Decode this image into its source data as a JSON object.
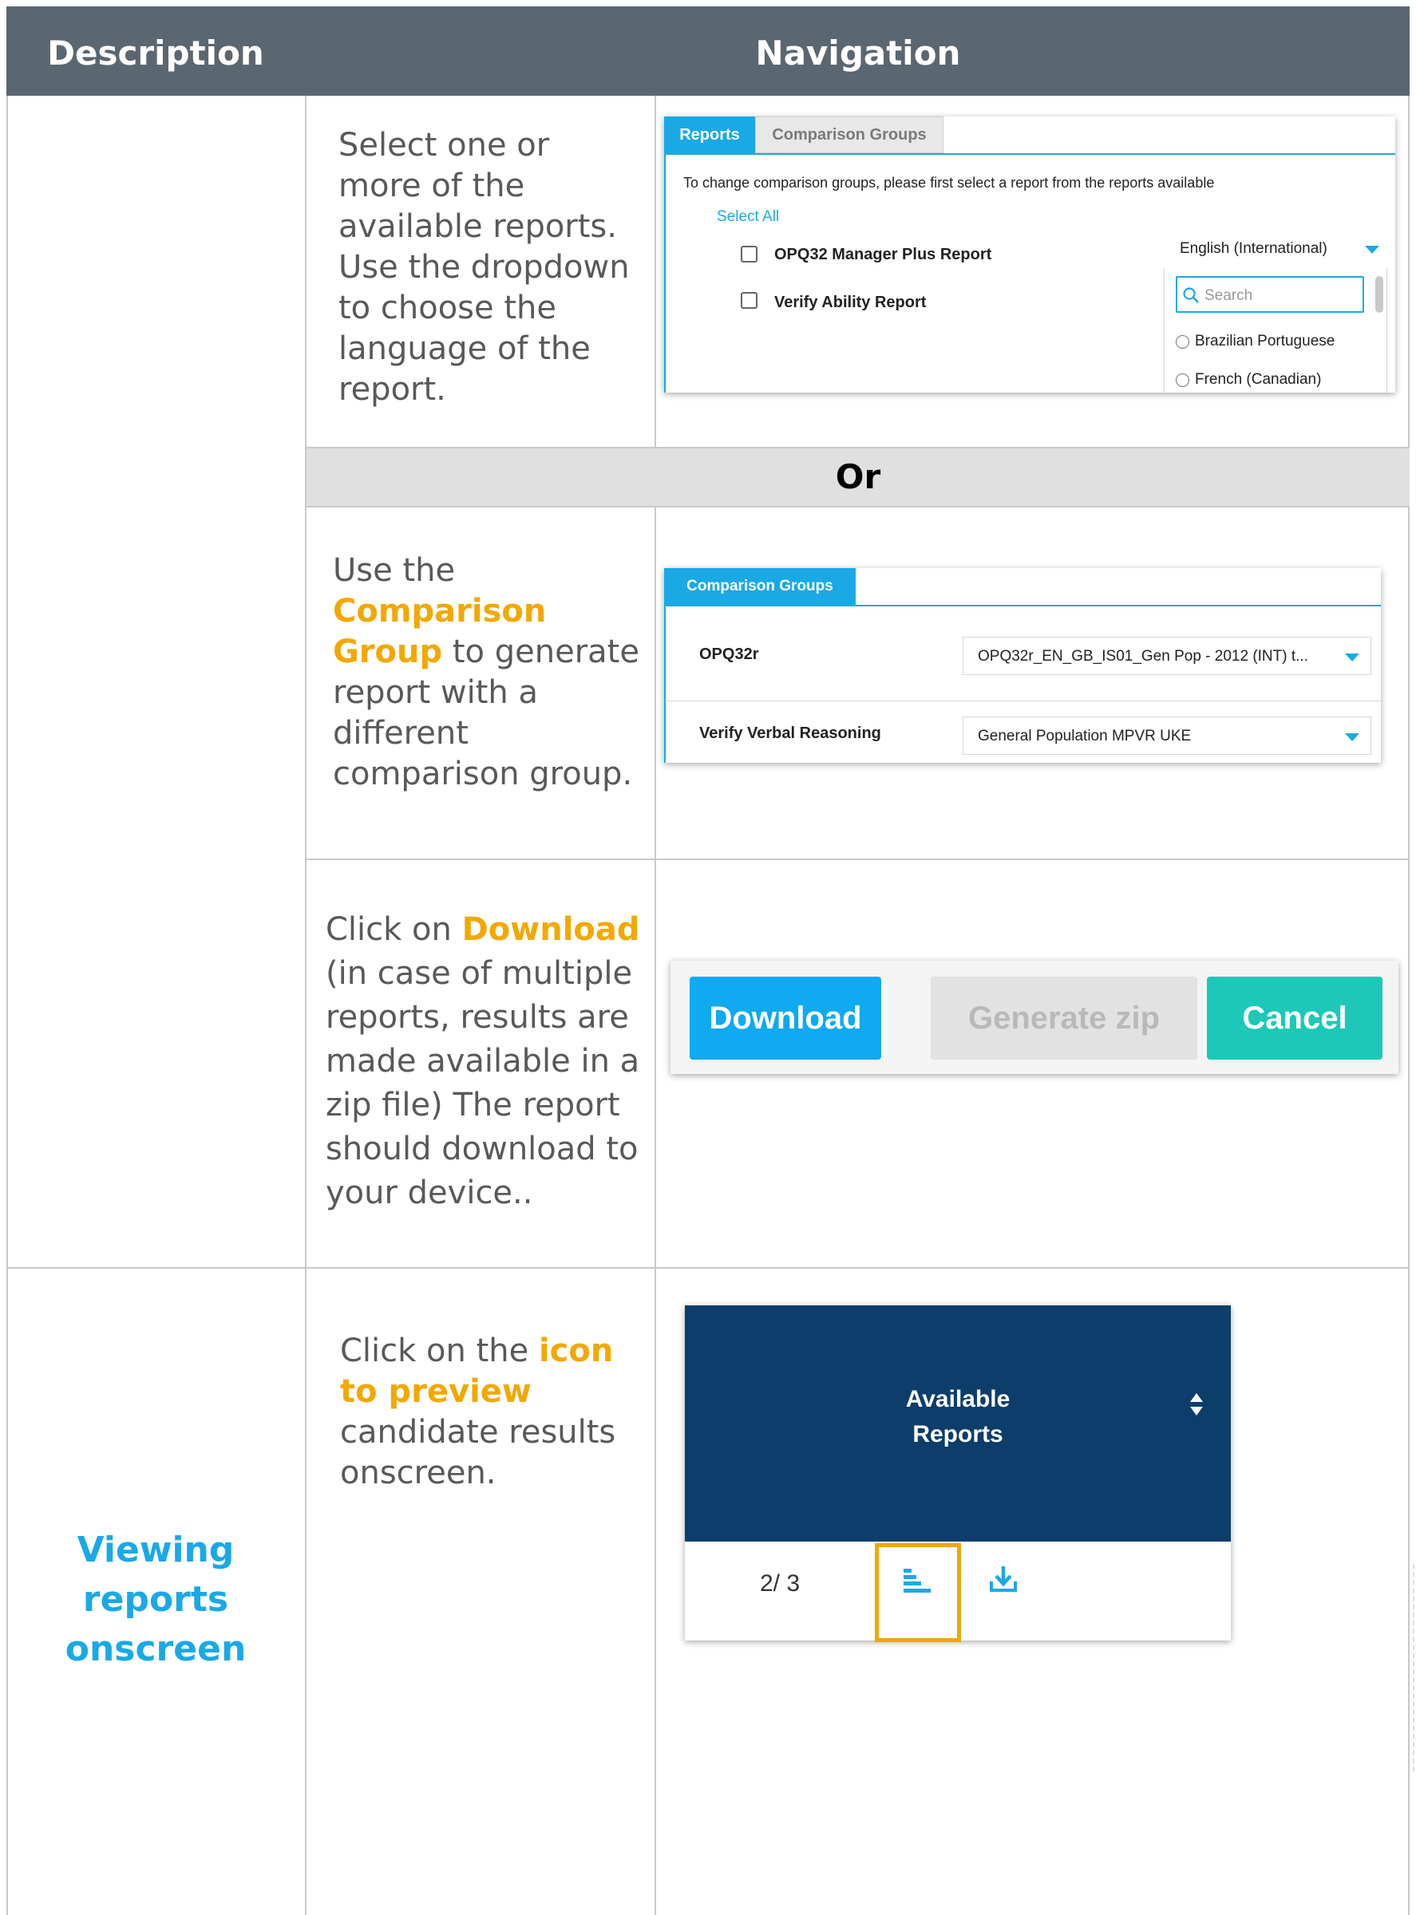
{
  "header": {
    "description": "Description",
    "navigation": "Navigation"
  },
  "rows": {
    "select_reports": {
      "text": "Select one or more of the available reports. Use the dropdown to choose the language of the report."
    },
    "or_label": "Or",
    "comparison": {
      "text_before": "Use the ",
      "highlight": "Comparison Group",
      "text_after": " to generate report with a different comparison group."
    },
    "download": {
      "text_before": "Click on ",
      "highlight": "Download",
      "text_after": " (in case of multiple reports, results are made available in a zip file) The report should download to your device.."
    },
    "viewing": {
      "section_title": "Viewing reports onscreen",
      "text_before": "Click on the ",
      "highlight": "icon to preview",
      "text_after": " candidate results onscreen."
    }
  },
  "reports_panel": {
    "tabs": [
      "Reports",
      "Comparison Groups"
    ],
    "instruction": "To change comparison groups, please first select a report from the reports available",
    "select_all": "Select All",
    "reports": [
      "OPQ32 Manager Plus Report",
      "Verify Ability Report"
    ],
    "language_selected": "English (International)",
    "search_placeholder": "Search",
    "language_options": [
      "Brazilian Portuguese",
      "French (Canadian)"
    ]
  },
  "comparison_panel": {
    "tab": "Comparison Groups",
    "rows": [
      {
        "label": "OPQ32r",
        "value": "OPQ32r_EN_GB_IS01_Gen Pop - 2012 (INT) t..."
      },
      {
        "label": "Verify Verbal Reasoning",
        "value": "General Population MPVR UKE"
      }
    ]
  },
  "buttons": {
    "download": "Download",
    "generate_zip": "Generate zip",
    "cancel": "Cancel"
  },
  "available_reports": {
    "title": "Available Reports",
    "count": "2/ 3",
    "icons": [
      "preview-chart-icon",
      "download-icon",
      "sort-icon"
    ]
  },
  "colors": {
    "header_bg": "#5b6770",
    "highlight": "#f2a800",
    "accent_blue": "#1aa9e5",
    "teal": "#1dc8b8",
    "navy": "#0c3d6b"
  }
}
